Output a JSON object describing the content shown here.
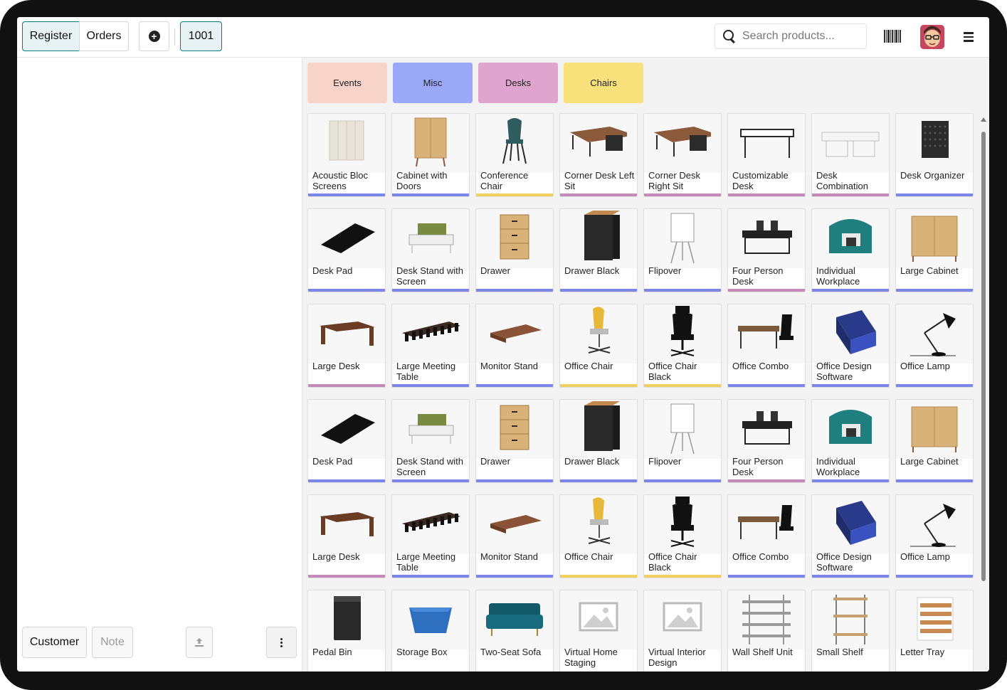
{
  "topbar": {
    "register_label": "Register",
    "orders_label": "Orders",
    "add_order_icon": "plus-circle-icon",
    "order_number": "1001",
    "search_placeholder": "Search products...",
    "barcode_icon": "barcode-icon",
    "avatar_icon": "user-avatar",
    "menu_icon": "hamburger-menu-icon"
  },
  "left_actions": {
    "customer_label": "Customer",
    "note_label": "Note",
    "upload_icon": "upload-icon",
    "more_icon": "kebab-menu-icon"
  },
  "categories": [
    {
      "label": "Events",
      "color": "#f8d4c8"
    },
    {
      "label": "Misc",
      "color": "#9aa8f8"
    },
    {
      "label": "Desks",
      "color": "#dfa5cf"
    },
    {
      "label": "Chairs",
      "color": "#f8e07a"
    }
  ],
  "category_bar_colors": {
    "misc": "#7b86e8",
    "desks": "#c48bb9",
    "chairs": "#f0d060"
  },
  "products": [
    [
      {
        "name": "Acoustic Bloc Screens",
        "icon": "screen-panel-icon",
        "bar": "misc"
      },
      {
        "name": "Cabinet with Doors",
        "icon": "cabinet-icon",
        "bar": "misc"
      },
      {
        "name": "Conference Chair",
        "icon": "chair-icon",
        "bar": "chairs"
      },
      {
        "name": "Corner Desk Left Sit",
        "icon": "corner-desk-icon",
        "bar": "desks"
      },
      {
        "name": "Corner Desk Right Sit",
        "icon": "corner-desk-icon",
        "bar": "desks"
      },
      {
        "name": "Customizable Desk",
        "icon": "desk-icon",
        "bar": "desks"
      },
      {
        "name": "Desk Combination",
        "icon": "desk-combo-icon",
        "bar": "desks"
      },
      {
        "name": "Desk Organizer",
        "icon": "organizer-icon",
        "bar": "misc"
      }
    ],
    [
      {
        "name": "Desk Pad",
        "icon": "desk-pad-icon",
        "bar": "misc"
      },
      {
        "name": "Desk Stand with Screen",
        "icon": "desk-stand-icon",
        "bar": "misc"
      },
      {
        "name": "Drawer",
        "icon": "drawer-icon",
        "bar": "misc"
      },
      {
        "name": "Drawer Black",
        "icon": "drawer-black-icon",
        "bar": "misc"
      },
      {
        "name": "Flipover",
        "icon": "flipover-icon",
        "bar": "misc"
      },
      {
        "name": "Four Person Desk",
        "icon": "four-person-desk-icon",
        "bar": "desks"
      },
      {
        "name": "Individual Workplace",
        "icon": "workplace-icon",
        "bar": "misc"
      },
      {
        "name": "Large Cabinet",
        "icon": "large-cabinet-icon",
        "bar": "misc"
      }
    ],
    [
      {
        "name": "Large Desk",
        "icon": "large-desk-icon",
        "bar": "desks"
      },
      {
        "name": "Large Meeting Table",
        "icon": "meeting-table-icon",
        "bar": "misc"
      },
      {
        "name": "Monitor Stand",
        "icon": "monitor-stand-icon",
        "bar": "misc"
      },
      {
        "name": "Office Chair",
        "icon": "office-chair-icon",
        "bar": "chairs"
      },
      {
        "name": "Office Chair Black",
        "icon": "office-chair-black-icon",
        "bar": "chairs"
      },
      {
        "name": "Office Combo",
        "icon": "office-combo-icon",
        "bar": "misc"
      },
      {
        "name": "Office Design Software",
        "icon": "software-box-icon",
        "bar": "misc"
      },
      {
        "name": "Office Lamp",
        "icon": "lamp-icon",
        "bar": "misc"
      }
    ],
    [
      {
        "name": "Desk Pad",
        "icon": "desk-pad-icon",
        "bar": "misc"
      },
      {
        "name": "Desk Stand with Screen",
        "icon": "desk-stand-icon",
        "bar": "misc"
      },
      {
        "name": "Drawer",
        "icon": "drawer-icon",
        "bar": "misc"
      },
      {
        "name": "Drawer Black",
        "icon": "drawer-black-icon",
        "bar": "misc"
      },
      {
        "name": "Flipover",
        "icon": "flipover-icon",
        "bar": "misc"
      },
      {
        "name": "Four Person Desk",
        "icon": "four-person-desk-icon",
        "bar": "desks"
      },
      {
        "name": "Individual Workplace",
        "icon": "workplace-icon",
        "bar": "misc"
      },
      {
        "name": "Large Cabinet",
        "icon": "large-cabinet-icon",
        "bar": "misc"
      }
    ],
    [
      {
        "name": "Large Desk",
        "icon": "large-desk-icon",
        "bar": "desks"
      },
      {
        "name": "Large Meeting Table",
        "icon": "meeting-table-icon",
        "bar": "misc"
      },
      {
        "name": "Monitor Stand",
        "icon": "monitor-stand-icon",
        "bar": "misc"
      },
      {
        "name": "Office Chair",
        "icon": "office-chair-icon",
        "bar": "chairs"
      },
      {
        "name": "Office Chair Black",
        "icon": "office-chair-black-icon",
        "bar": "chairs"
      },
      {
        "name": "Office Combo",
        "icon": "office-combo-icon",
        "bar": "misc"
      },
      {
        "name": "Office Design Software",
        "icon": "software-box-icon",
        "bar": "misc"
      },
      {
        "name": "Office Lamp",
        "icon": "lamp-icon",
        "bar": "misc"
      }
    ],
    [
      {
        "name": "Pedal Bin",
        "icon": "pedal-bin-icon",
        "bar": "none"
      },
      {
        "name": "Storage Box",
        "icon": "storage-box-icon",
        "bar": "none"
      },
      {
        "name": "Two-Seat Sofa",
        "icon": "sofa-icon",
        "bar": "none"
      },
      {
        "name": "Virtual Home Staging",
        "icon": "image-placeholder-icon",
        "bar": "none"
      },
      {
        "name": "Virtual Interior Design",
        "icon": "image-placeholder-icon",
        "bar": "none"
      },
      {
        "name": "Wall Shelf Unit",
        "icon": "wall-shelf-icon",
        "bar": "none"
      },
      {
        "name": "Small Shelf",
        "icon": "small-shelf-icon",
        "bar": "none"
      },
      {
        "name": "Letter Tray",
        "icon": "letter-tray-icon",
        "bar": "none"
      }
    ]
  ]
}
